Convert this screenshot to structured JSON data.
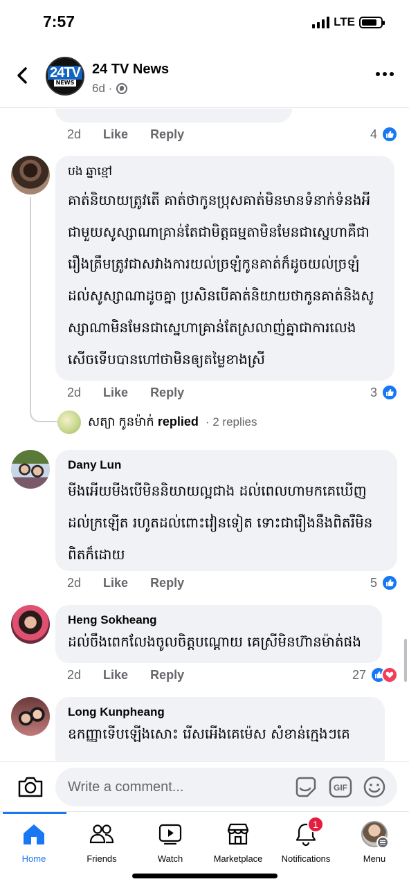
{
  "status_bar": {
    "time": "7:57",
    "network": "LTE"
  },
  "header": {
    "page_name": "24 TV News",
    "meta": "6d ·",
    "logo_text": "24TV",
    "logo_sub": "NEWS"
  },
  "comments": [
    {
      "id": "c0",
      "time": "2d",
      "like_label": "Like",
      "reply_label": "Reply",
      "reaction_count": "4"
    },
    {
      "id": "c1",
      "author": "បង ឆ្នាខ្មៅ",
      "lines": [
        "គាត់និយាយត្រូវតើ គាត់ថាកូនប្រុសគាត់មិនមានទំនាក់ទំនងអី",
        "ជាមួយសូស្សាណាគ្រាន់តែជាមិត្តធម្មតាមិនមែនជាស្នេហាគឺជា",
        "រឿងត្រឹមត្រូវជាសវាងការយល់ច្រឡំកូនគាត់ក៏ដូចយល់ច្រឡំ",
        "ដល់សូស្សាណាដូចគ្នា ប្រសិនបើគាត់និយាយថាកូនគាត់និងសូ",
        "ស្សាណាមិនមែនជាស្នេហាគ្រាន់តែស្រលាញ់គ្នាជាការលេង",
        "សើចទើបបានហៅថាមិនឲ្យតម្លៃខាងស្រី"
      ],
      "time": "2d",
      "like_label": "Like",
      "reply_label": "Reply",
      "reaction_count": "3",
      "replied": {
        "name": "សត្យា កូនម៉ាក់",
        "action": "replied",
        "count": "· 2 replies"
      }
    },
    {
      "id": "c2",
      "author": "Dany Lun",
      "lines": [
        "មីងអើយមីងបើមិននិយាយល្អជាង ដល់ពេលហាមកគេឃើញ",
        "ដល់ក្រឡើត រហូតដល់ពោះវៀនទៀត ទោះជារឿងនឹងពិតរឺមិន",
        "ពិតក៏ដោយ"
      ],
      "time": "2d",
      "like_label": "Like",
      "reply_label": "Reply",
      "reaction_count": "5"
    },
    {
      "id": "c3",
      "author": "Heng Sokheang",
      "lines": [
        "ដល់ចឹងពេកលែងចូលចិត្តបណ្ដោយ គេស្រីមិនហ៊ានម៉ាត់ផង"
      ],
      "time": "2d",
      "like_label": "Like",
      "reply_label": "Reply",
      "reaction_count": "27"
    },
    {
      "id": "c4",
      "author": "Long Kunpheang",
      "lines": [
        "ឧកញ្ញាទើបឡើងសោះ រើសអើងគេម៉េស សំខាន់ក្មេងៗគេ"
      ]
    }
  ],
  "composer": {
    "placeholder": "Write a comment..."
  },
  "nav": {
    "items": [
      {
        "label": "Home"
      },
      {
        "label": "Friends"
      },
      {
        "label": "Watch"
      },
      {
        "label": "Marketplace"
      },
      {
        "label": "Notifications",
        "badge": "1"
      },
      {
        "label": "Menu"
      }
    ]
  },
  "colors": {
    "accent": "#1877f2",
    "bubble": "#f0f2f5",
    "secondary_text": "#65676b",
    "badge": "#e41e3f",
    "heart": "#f33e58"
  }
}
